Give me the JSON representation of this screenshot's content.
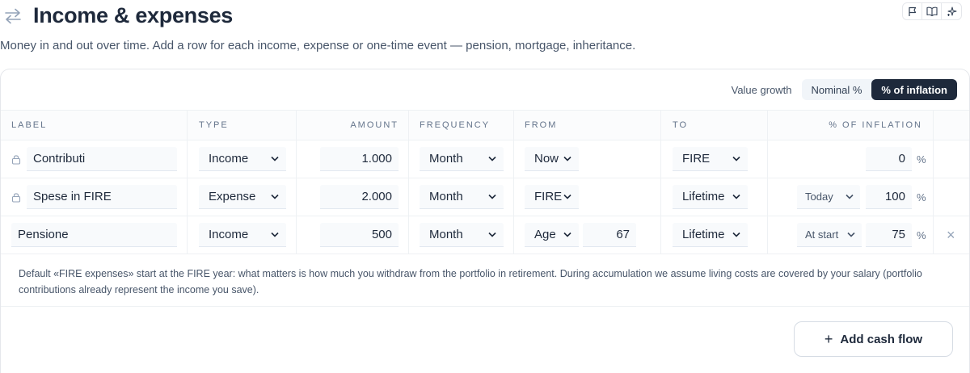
{
  "header": {
    "title": "Income & expenses",
    "subtitle": "Money in and out over time. Add a row for each income, expense or one-time event — pension, mortgage, inheritance.",
    "tool_icons": [
      "flag-icon",
      "book-icon",
      "sparkle-icon"
    ]
  },
  "growth": {
    "label": "Value growth",
    "options": [
      "Nominal %",
      "% of inflation"
    ],
    "selected": "% of inflation"
  },
  "table": {
    "columns": [
      "LABEL",
      "TYPE",
      "AMOUNT",
      "FREQUENCY",
      "FROM",
      "TO",
      "% OF INFLATION"
    ],
    "rows": [
      {
        "locked": true,
        "label": "Contributi",
        "type": "Income",
        "amount": "1.000",
        "frequency": "Month",
        "from": "Now",
        "from_age": "",
        "to": "FIRE",
        "timing": "",
        "inflation": "0",
        "pct": "%",
        "removable": false
      },
      {
        "locked": true,
        "label": "Spese in FIRE",
        "type": "Expense",
        "amount": "2.000",
        "frequency": "Month",
        "from": "FIRE",
        "from_age": "",
        "to": "Lifetime",
        "timing": "Today",
        "inflation": "100",
        "pct": "%",
        "removable": false
      },
      {
        "locked": false,
        "label": "Pensione",
        "type": "Income",
        "amount": "500",
        "frequency": "Month",
        "from": "Age",
        "from_age": "67",
        "to": "Lifetime",
        "timing": "At start",
        "inflation": "75",
        "pct": "%",
        "removable": true
      }
    ]
  },
  "note": "Default «FIRE expenses» start at the FIRE year: what matters is how much you withdraw from the portfolio in retirement. During accumulation we assume living costs are covered by your salary (portfolio contributions already represent the income you save).",
  "actions": {
    "add_label": "Add cash flow",
    "remove_symbol": "×"
  },
  "colors": {
    "accent": "#1e293b",
    "muted": "#64748b"
  }
}
